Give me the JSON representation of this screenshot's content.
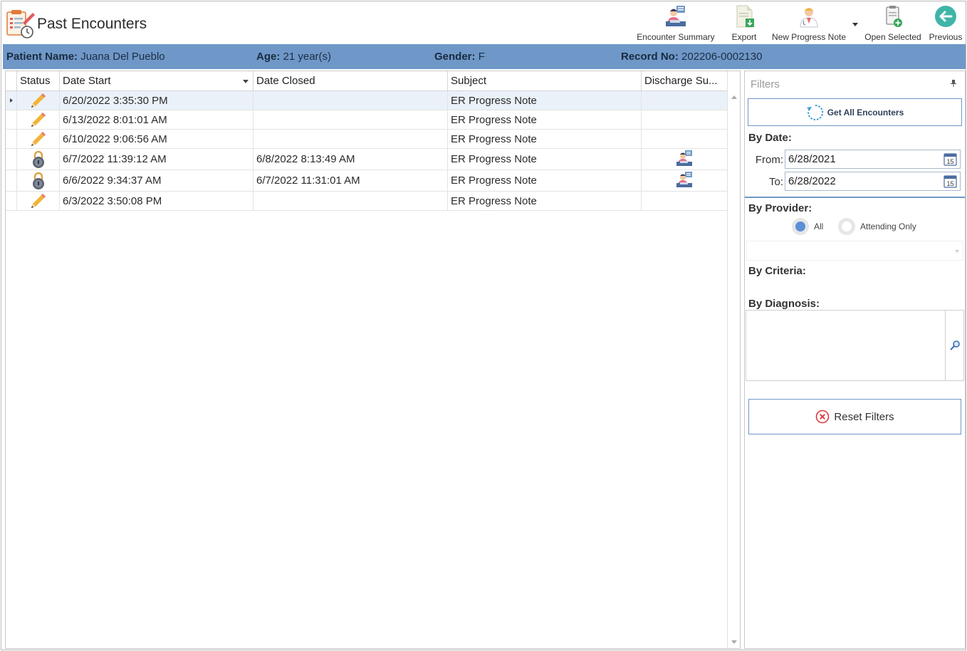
{
  "header": {
    "title": "Past Encounters",
    "toolbar": [
      {
        "label": "Encounter Summary",
        "icon": "encounter-summary-icon"
      },
      {
        "label": "Export",
        "icon": "export-icon"
      },
      {
        "label": "New Progress Note",
        "icon": "doctor-icon"
      },
      {
        "label": "Open Selected",
        "icon": "open-document-icon"
      },
      {
        "label": "Previous",
        "icon": "back-arrow-icon"
      }
    ]
  },
  "patient": {
    "name_label": "Patient Name:",
    "name": "Juana Del Pueblo",
    "age_label": "Age:",
    "age": "21 year(s)",
    "gender_label": "Gender:",
    "gender": "F",
    "record_label": "Record No:",
    "record": "202206-0002130"
  },
  "grid": {
    "columns": [
      "Status",
      "Date Start",
      "Date Closed",
      "Subject",
      "Discharge Su..."
    ],
    "rows": [
      {
        "status": "pencil-icon",
        "date_start": "6/20/2022 3:35:30 PM",
        "date_closed": "",
        "subject": "ER Progress Note",
        "discharge": false,
        "selected": true
      },
      {
        "status": "pencil-icon",
        "date_start": "6/13/2022 8:01:01 AM",
        "date_closed": "",
        "subject": "ER Progress Note",
        "discharge": false,
        "selected": false
      },
      {
        "status": "pencil-icon",
        "date_start": "6/10/2022 9:06:56 AM",
        "date_closed": "",
        "subject": "ER Progress Note",
        "discharge": false,
        "selected": false
      },
      {
        "status": "lock-icon",
        "date_start": "6/7/2022 11:39:12 AM",
        "date_closed": "6/8/2022 8:13:49 AM",
        "subject": "ER Progress Note",
        "discharge": true,
        "selected": false
      },
      {
        "status": "lock-icon",
        "date_start": "6/6/2022 9:34:37 AM",
        "date_closed": "6/7/2022 11:31:01 AM",
        "subject": "ER Progress Note",
        "discharge": true,
        "selected": false
      },
      {
        "status": "pencil-icon",
        "date_start": "6/3/2022 3:50:08 PM",
        "date_closed": "",
        "subject": "ER Progress Note",
        "discharge": false,
        "selected": false
      }
    ]
  },
  "filters": {
    "title": "Filters",
    "get_all_label": "Get All Encounters",
    "by_date_label": "By Date:",
    "from_label": "From:",
    "from_value": "6/28/2021",
    "to_label": "To:",
    "to_value": "6/28/2022",
    "calendar_day": "15",
    "by_provider_label": "By Provider:",
    "provider_options": [
      {
        "label": "All",
        "checked": true
      },
      {
        "label": "Attending Only",
        "checked": false
      }
    ],
    "by_criteria_label": "By Criteria:",
    "by_diagnosis_label": "By Diagnosis:",
    "reset_label": "Reset Filters"
  },
  "colors": {
    "accent": "#6f98c8",
    "selected_row": "#eaf1f9",
    "radio_checked": "#5b8fd6",
    "reset_icon": "#e0393e",
    "previous_button": "#3fb5a7"
  }
}
